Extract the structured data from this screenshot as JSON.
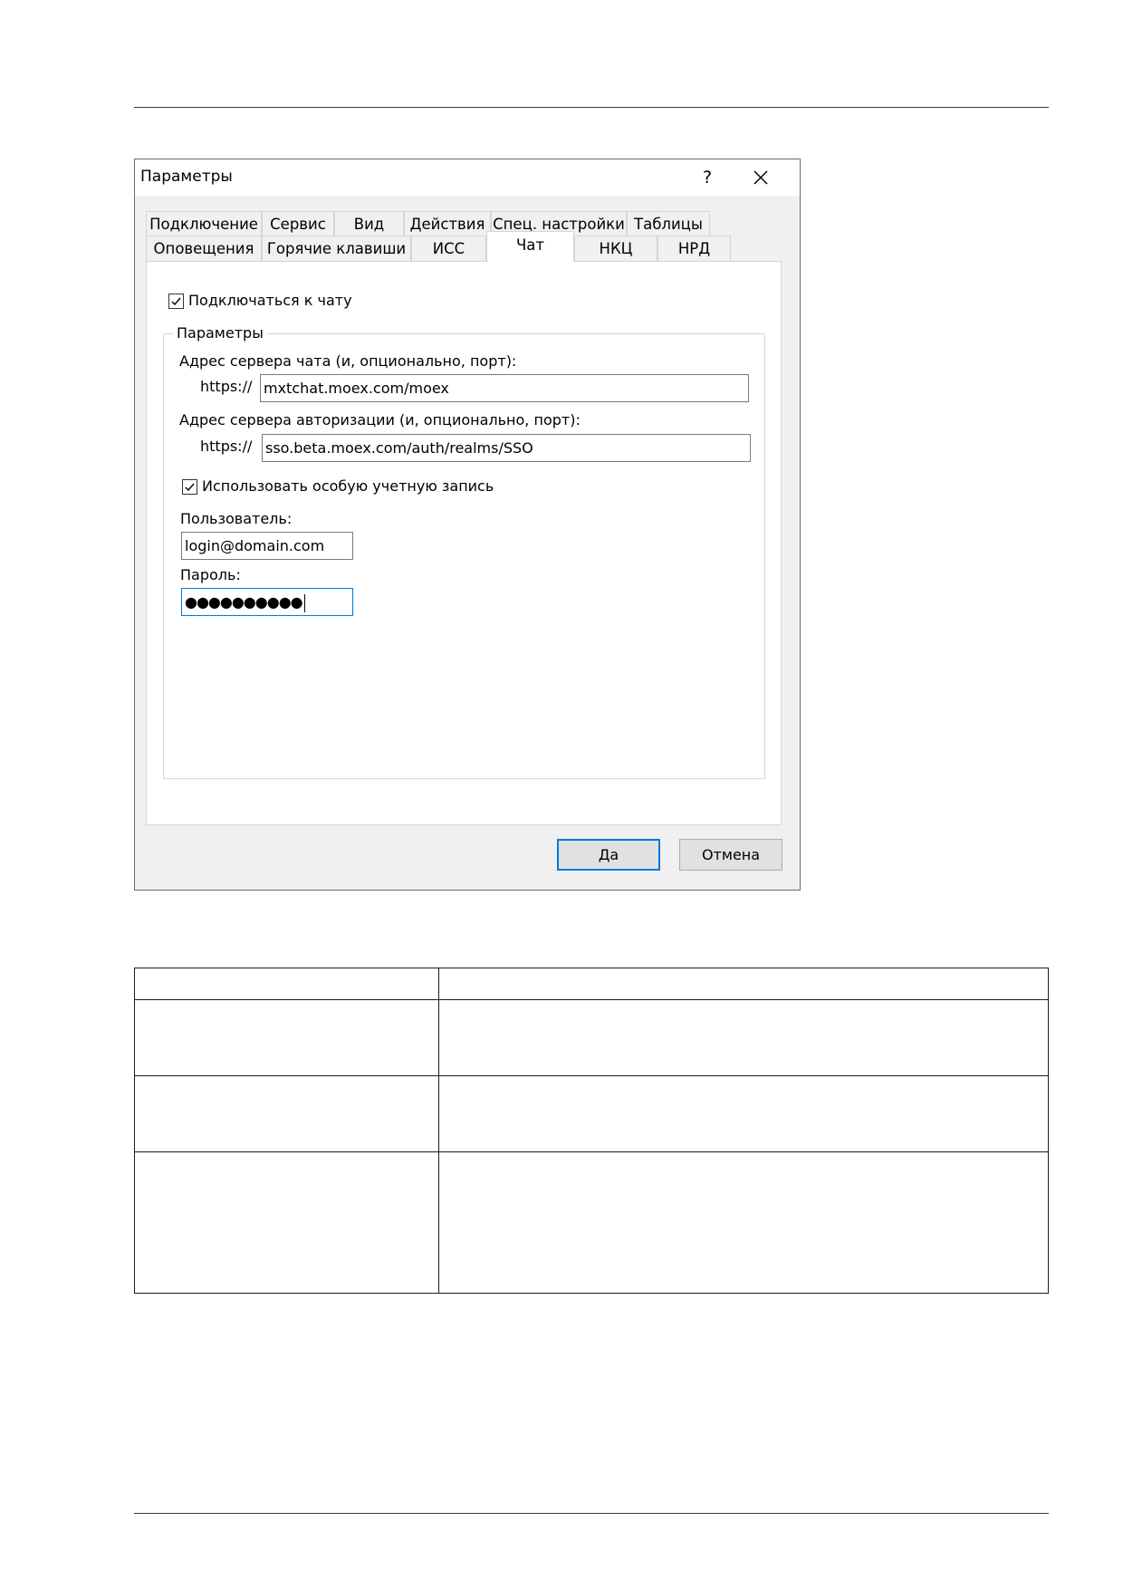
{
  "dialog": {
    "title": "Параметры",
    "help_glyph": "?",
    "tabs_row1": [
      "Подключение",
      "Сервис",
      "Вид",
      "Действия",
      "Спец. настройки",
      "Таблицы"
    ],
    "tabs_row2": [
      "Оповещения",
      "Горячие клавиши",
      "ИСС",
      "Чат",
      "НКЦ",
      "НРД"
    ],
    "active_tab": "Чат",
    "connect_chat": {
      "label": "Подключаться к чату",
      "checked": true
    },
    "params_group": {
      "title": "Параметры",
      "chat_server_label": "Адрес сервера чата (и, опционально, порт):",
      "chat_server_prefix": "https://",
      "chat_server_value": "mxtchat.moex.com/moex",
      "auth_server_label": "Адрес сервера авторизации (и, опционально, порт):",
      "auth_server_prefix": "https://",
      "auth_server_value": "sso.beta.moex.com/auth/realms/SSO",
      "custom_account": {
        "label": "Использовать особую учетную запись",
        "checked": true
      },
      "user_label": "Пользователь:",
      "user_value": "login@domain.com",
      "password_label": "Пароль:",
      "password_value": "●●●●●●●●●●"
    },
    "ok_label": "Да",
    "cancel_label": "Отмена",
    "accent_color": "#0078d7"
  },
  "table": {
    "headers": [
      "",
      ""
    ],
    "rows": [
      [
        "",
        ""
      ],
      [
        "",
        ""
      ],
      [
        "",
        ""
      ]
    ]
  }
}
